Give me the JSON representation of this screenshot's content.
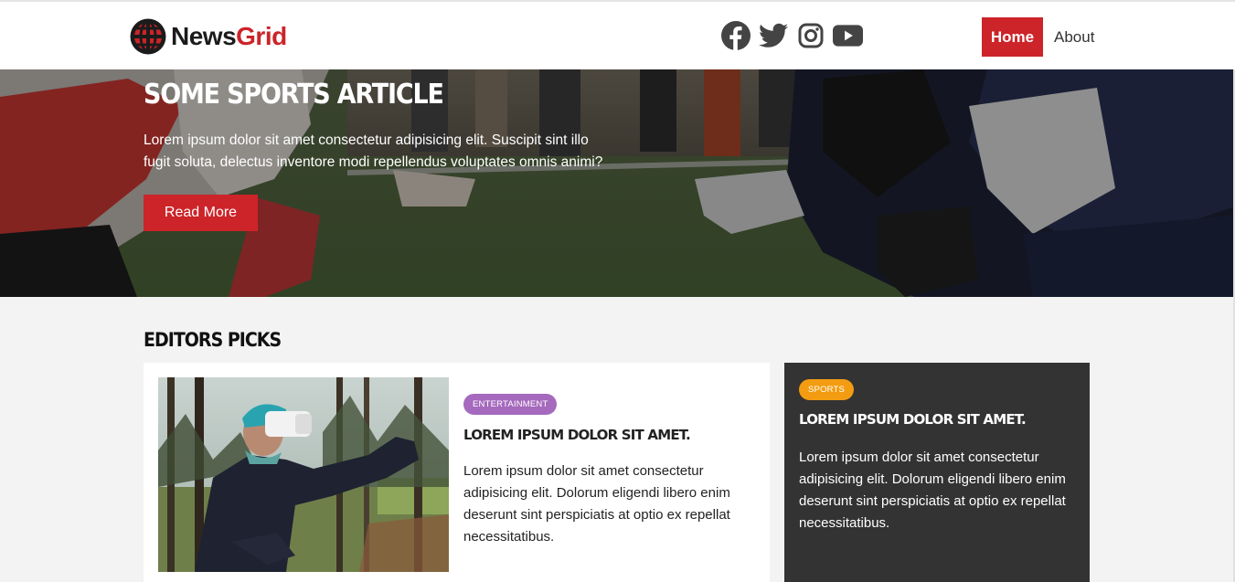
{
  "brand": {
    "name_part1": "News",
    "name_part2": "Grid",
    "accent": "#cc2429"
  },
  "social": [
    {
      "icon": "facebook-icon"
    },
    {
      "icon": "twitter-icon"
    },
    {
      "icon": "instagram-icon"
    },
    {
      "icon": "youtube-icon"
    }
  ],
  "nav": {
    "home": "Home",
    "about": "About"
  },
  "hero": {
    "title": "SOME SPORTS ARTICLE",
    "text": "Lorem ipsum dolor sit amet consectetur adipisicing elit. Suscipit sint illo fugit soluta, delectus inventore modi repellendus voluptates omnis animi?",
    "button": "Read More"
  },
  "editors_picks": {
    "heading": "EDITORS PICKS",
    "main_card": {
      "category": "ENTERTAINMENT",
      "category_color": "#a569bd",
      "title": "LOREM IPSUM DOLOR SIT AMET.",
      "text": "Lorem ipsum dolor sit amet consectetur adipisicing elit. Dolorum eligendi libero enim deserunt sint perspiciatis at optio ex repellat necessitatibus."
    },
    "side_card": {
      "category": "SPORTS",
      "category_color": "#f39c12",
      "title": "LOREM IPSUM DOLOR SIT AMET.",
      "text": "Lorem ipsum dolor sit amet consectetur adipisicing elit. Dolorum eligendi libero enim deserunt sint perspiciatis at optio ex repellat necessitatibus."
    }
  }
}
